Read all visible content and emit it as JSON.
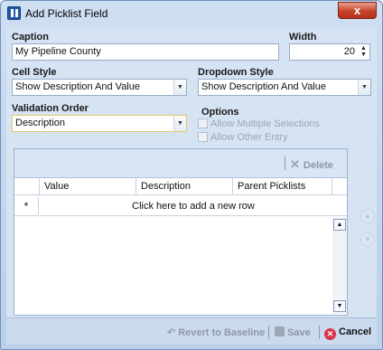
{
  "window": {
    "title": "Add Picklist Field",
    "close_label": "x"
  },
  "form": {
    "caption_label": "Caption",
    "caption_value": "My Pipeline County",
    "width_label": "Width",
    "width_value": "20",
    "cell_style_label": "Cell Style",
    "cell_style_value": "Show Description And Value",
    "dropdown_style_label": "Dropdown Style",
    "dropdown_style_value": "Show Description And Value",
    "validation_order_label": "Validation Order",
    "validation_order_value": "Description",
    "options_label": "Options",
    "option_multiple": "Allow Multiple Selections",
    "option_other": "Allow Other Entry"
  },
  "grid": {
    "delete_label": "Delete",
    "columns": [
      "Value",
      "Description",
      "Parent Picklists"
    ],
    "new_row_marker": "*",
    "new_row_text": "Click here to add a new row"
  },
  "footer": {
    "revert_label": "Revert to Baseline",
    "save_label": "Save",
    "cancel_label": "Cancel"
  },
  "icons": {
    "app": "picklist-icon",
    "delete": "delete-x-icon",
    "revert": "revert-icon",
    "save": "save-disk-icon",
    "cancel": "cancel-icon",
    "move_up": "move-up-icon",
    "move_down": "move-down-icon"
  },
  "colors": {
    "dialog_bg": "#d5e3f3",
    "close_button": "#c7432a",
    "cancel_icon": "#d8344a",
    "focus_border": "#e3c76a"
  }
}
